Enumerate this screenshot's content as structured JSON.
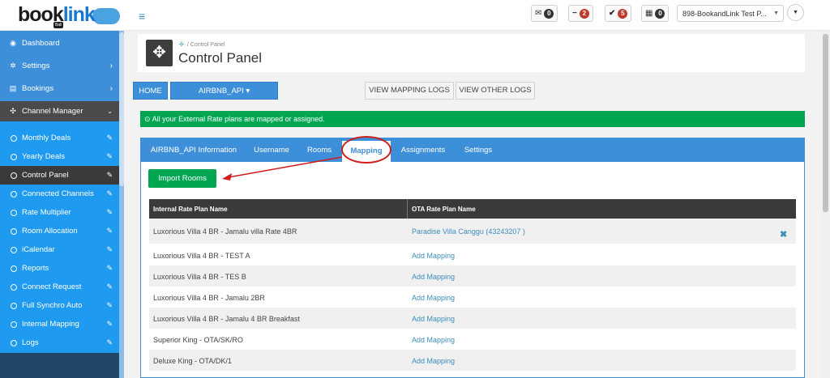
{
  "header": {
    "logo_main": "book",
    "logo_accent": "link",
    "logo_tag": "Bali",
    "messages_count": "0",
    "minus_count": "2",
    "check_count": "5",
    "calendar_count": "0",
    "property_select": "898-BookandLink Test P..."
  },
  "sidebar": {
    "dashboard": "Dashboard",
    "settings": "Settings",
    "bookings": "Bookings",
    "channel_manager": "Channel Manager",
    "subitems": [
      "Monthly Deals",
      "Yearly Deals",
      "Control Panel",
      "Connected Channels",
      "Rate Multiplier",
      "Room Allocation",
      "iCalendar",
      "Reports",
      "Connect Request",
      "Full Synchro Auto",
      "Internal Mapping",
      "Logs"
    ]
  },
  "page": {
    "breadcrumb": "Control Panel",
    "title": "Control Panel",
    "home_btn": "HOME",
    "channel_btn": "AIRBNB_API ▾",
    "view_mapping_logs": "VIEW MAPPING LOGS",
    "view_other_logs": "VIEW OTHER LOGS",
    "alert": "All your External Rate plans are mapped or assigned."
  },
  "tabs": [
    "AIRBNB_API Information",
    "Username",
    "Rooms",
    "Mapping",
    "Assignments",
    "Settings"
  ],
  "import_btn": "Import Rooms",
  "table": {
    "col1": "Internal Rate Plan Name",
    "col2": "OTA Rate Plan Name",
    "rows": [
      {
        "internal": "Luxorious Villa 4 BR - Jamalu villa Rate 4BR",
        "ota": "Paradise Villa Canggu (43243207 )",
        "remove": "✖"
      },
      {
        "internal": "Luxorious Villa 4 BR - TEST A",
        "ota": "Add Mapping"
      },
      {
        "internal": "Luxorious Villa 4 BR - TES B",
        "ota": "Add Mapping"
      },
      {
        "internal": "Luxorious Villa 4 BR - Jamalu 2BR",
        "ota": "Add Mapping"
      },
      {
        "internal": "Luxorious Villa 4 BR - Jamalu 4 BR Breakfast",
        "ota": "Add Mapping"
      },
      {
        "internal": "Superior King - OTA/SK/RO",
        "ota": "Add Mapping"
      },
      {
        "internal": "Deluxe King - OTA/DK/1",
        "ota": "Add Mapping"
      }
    ]
  },
  "colors": {
    "primary": "#3d8fd9",
    "success": "#00a651",
    "danger": "#d11c1c",
    "dark": "#3a3a3a"
  }
}
